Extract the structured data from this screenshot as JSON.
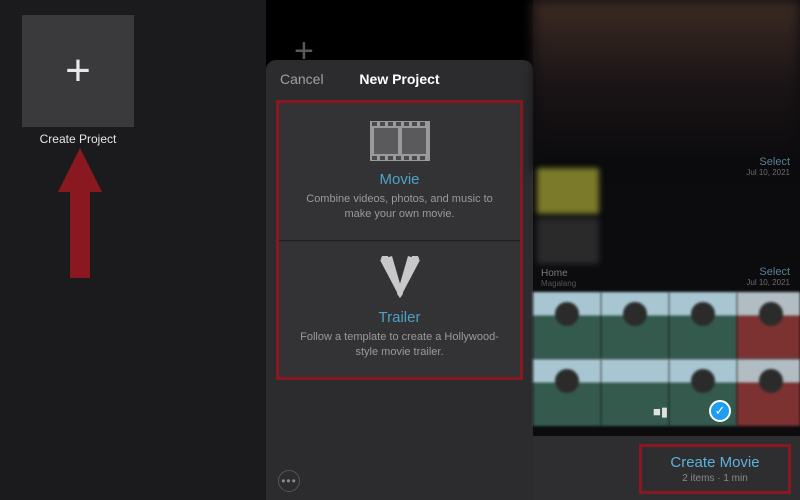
{
  "panel1": {
    "create_label": "Create Project"
  },
  "panel2": {
    "cancel_label": "Cancel",
    "sheet_title": "New Project",
    "movie": {
      "title": "Movie",
      "desc": "Combine videos, photos, and music to make your own movie."
    },
    "trailer": {
      "title": "Trailer",
      "desc": "Follow a template to create a Hollywood-style movie trailer."
    }
  },
  "panel3": {
    "select_label": "Select",
    "select_date": "Jul 10, 2021",
    "album_name": "Home",
    "album_sub": "Magalang",
    "create_movie": "Create Movie",
    "create_movie_sub": "2 items · 1 min"
  }
}
